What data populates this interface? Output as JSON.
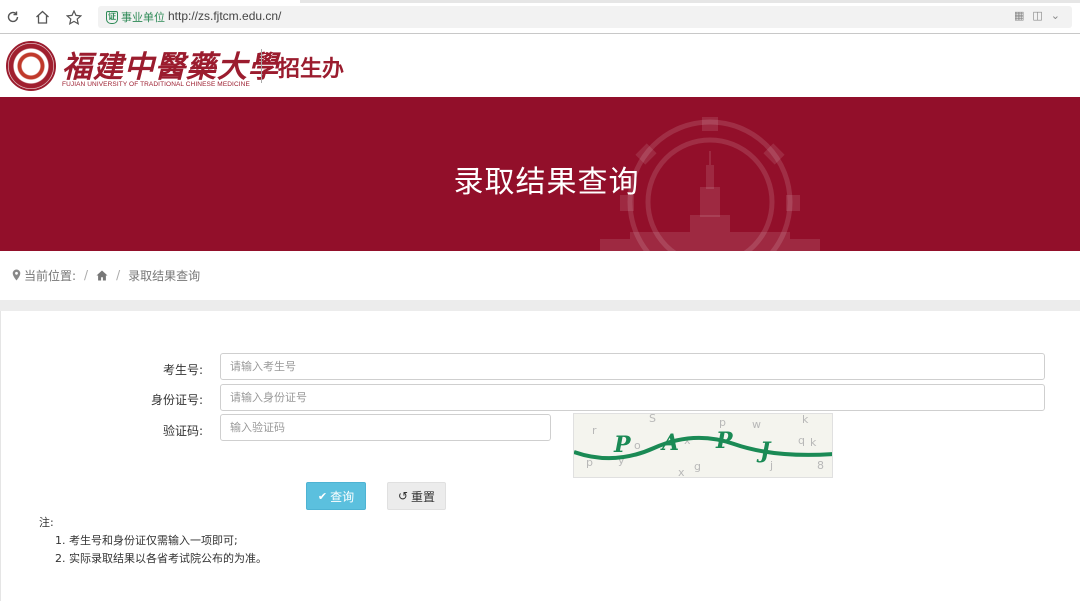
{
  "browser": {
    "cert_label": "事业单位",
    "url": "http://zs.fjtcm.edu.cn/"
  },
  "header": {
    "school_name_cn": "福建中醫藥大學",
    "school_name_en": "FUJIAN UNIVERSITY OF TRADITIONAL CHINESE MEDICINE",
    "dept": "招生办"
  },
  "banner": {
    "title": "录取结果查询"
  },
  "breadcrumb": {
    "current_location": "当前位置:",
    "page": "录取结果查询"
  },
  "form": {
    "exam_no_label": "考生号:",
    "exam_no_placeholder": "请输入考生号",
    "id_label": "身份证号:",
    "id_placeholder": "请输入身份证号",
    "captcha_label": "验证码:",
    "captcha_placeholder": "输入验证码",
    "query_button": "查询",
    "reset_button": "重置"
  },
  "notes": {
    "title": "注:",
    "items": [
      "1.  考生号和身份证仅需输入一项即可;",
      "2.  实际录取结果以各省考试院公布的为准。"
    ]
  },
  "colors": {
    "brand": "#920f2a",
    "query_button": "#5bc0de"
  }
}
